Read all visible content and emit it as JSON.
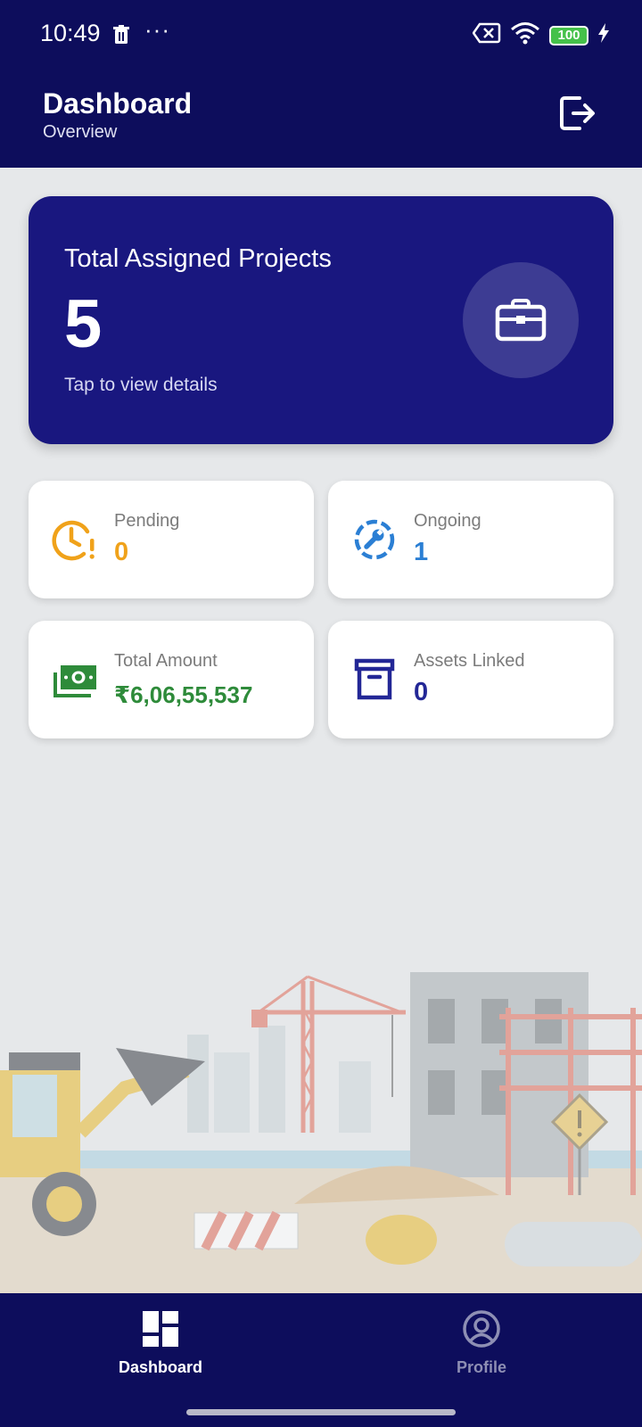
{
  "status_bar": {
    "time": "10:49",
    "more": "···",
    "battery": "100"
  },
  "header": {
    "title": "Dashboard",
    "subtitle": "Overview"
  },
  "hero_card": {
    "title": "Total Assigned Projects",
    "value": "5",
    "hint": "Tap to view details"
  },
  "stats": {
    "pending": {
      "label": "Pending",
      "value": "0",
      "color": "#f0a21a"
    },
    "ongoing": {
      "label": "Ongoing",
      "value": "1",
      "color": "#2b7fd4"
    },
    "total_amount": {
      "label": "Total Amount",
      "value": "₹6,06,55,537",
      "color": "#2e8b3a"
    },
    "assets_linked": {
      "label": "Assets Linked",
      "value": "0",
      "color": "#232796"
    }
  },
  "bottom_nav": {
    "dashboard": "Dashboard",
    "profile": "Profile"
  },
  "colors": {
    "primary": "#0d0d5c",
    "hero": "#19177f"
  }
}
